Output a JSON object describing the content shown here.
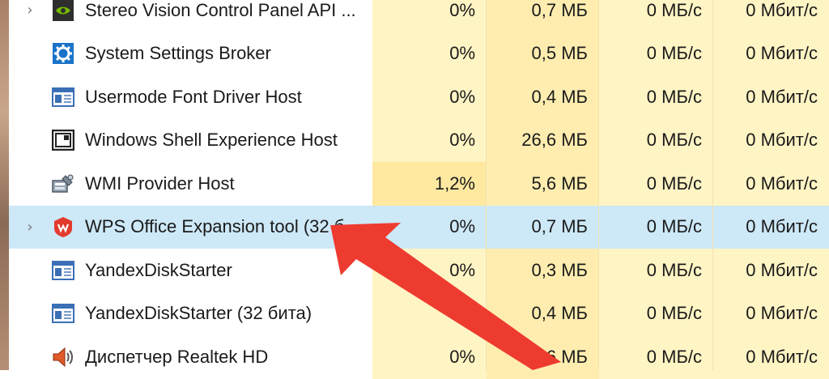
{
  "rows": [
    {
      "name": "Stereo Vision Control Panel API ...",
      "cpu": "0%",
      "mem": "0,7 МБ",
      "disk": "0 МБ/с",
      "net": "0 Мбит/с",
      "expand": "›",
      "icon": "nvidia-icon",
      "selected": false
    },
    {
      "name": "System Settings Broker",
      "cpu": "0%",
      "mem": "0,5 МБ",
      "disk": "0 МБ/с",
      "net": "0 Мбит/с",
      "expand": "",
      "icon": "gear-icon",
      "selected": false
    },
    {
      "name": "Usermode Font Driver Host",
      "cpu": "0%",
      "mem": "0,4 МБ",
      "disk": "0 МБ/с",
      "net": "0 Мбит/с",
      "expand": "",
      "icon": "window-icon",
      "selected": false
    },
    {
      "name": "Windows Shell Experience Host",
      "cpu": "0%",
      "mem": "26,6 МБ",
      "disk": "0 МБ/с",
      "net": "0 Мбит/с",
      "expand": "",
      "icon": "shell-window-icon",
      "selected": false
    },
    {
      "name": "WMI Provider Host",
      "cpu": "1,2%",
      "mem": "5,6 МБ",
      "disk": "0 МБ/с",
      "net": "0 Мбит/с",
      "expand": "",
      "icon": "wmi-icon",
      "selected": false
    },
    {
      "name": "WPS Office Expansion tool (32 б...",
      "cpu": "0%",
      "mem": "0,7 МБ",
      "disk": "0 МБ/с",
      "net": "0 Мбит/с",
      "expand": "›",
      "icon": "wps-icon",
      "selected": true
    },
    {
      "name": "YandexDiskStarter",
      "cpu": "0%",
      "mem": "0,3 МБ",
      "disk": "0 МБ/с",
      "net": "0 Мбит/с",
      "expand": "",
      "icon": "window-icon",
      "selected": false
    },
    {
      "name": "YandexDiskStarter (32 бита)",
      "cpu": "0%",
      "mem": "0,4 МБ",
      "disk": "0 МБ/с",
      "net": "0 Мбит/с",
      "expand": "",
      "icon": "window-icon",
      "selected": false
    },
    {
      "name": "Диспетчер Realtek HD",
      "cpu": "0%",
      "mem": "0,6 МБ",
      "disk": "0 МБ/с",
      "net": "0 Мбит/с",
      "expand": "",
      "icon": "speaker-icon",
      "selected": false
    }
  ],
  "annotation": {
    "arrow_color": "#ee3b30"
  }
}
